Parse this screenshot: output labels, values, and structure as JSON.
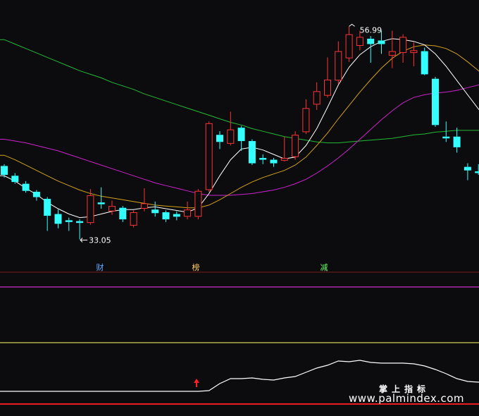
{
  "chart_data": {
    "type": "candlestick",
    "ylim": [
      30,
      59
    ],
    "price_labels": {
      "high": "56.99",
      "low": "33.05"
    },
    "event_markers": [
      "财",
      "榜",
      "减"
    ],
    "candles": [
      {
        "o": 41.3,
        "c": 40.3,
        "h": 41.5,
        "l": 40.0,
        "up": false
      },
      {
        "o": 40.2,
        "c": 39.5,
        "h": 40.5,
        "l": 39.3,
        "up": false
      },
      {
        "o": 39.3,
        "c": 38.5,
        "h": 39.6,
        "l": 38.3,
        "up": false
      },
      {
        "o": 38.4,
        "c": 37.8,
        "h": 38.6,
        "l": 37.4,
        "up": false
      },
      {
        "o": 37.6,
        "c": 35.7,
        "h": 37.8,
        "l": 34.0,
        "up": false
      },
      {
        "o": 35.9,
        "c": 34.8,
        "h": 36.4,
        "l": 34.3,
        "up": false
      },
      {
        "o": 35.2,
        "c": 35.0,
        "h": 35.5,
        "l": 34.0,
        "up": false
      },
      {
        "o": 35.1,
        "c": 34.9,
        "h": 35.3,
        "l": 33.05,
        "up": false
      },
      {
        "o": 34.9,
        "c": 38.0,
        "h": 38.7,
        "l": 34.7,
        "up": true
      },
      {
        "o": 37.2,
        "c": 37.0,
        "h": 38.9,
        "l": 36.5,
        "up": false
      },
      {
        "o": 36.8,
        "c": 36.2,
        "h": 37.4,
        "l": 35.8,
        "up": true
      },
      {
        "o": 36.6,
        "c": 35.3,
        "h": 36.8,
        "l": 35.0,
        "up": false
      },
      {
        "o": 34.6,
        "c": 36.1,
        "h": 36.3,
        "l": 34.4,
        "up": true
      },
      {
        "o": 36.5,
        "c": 37.1,
        "h": 38.8,
        "l": 36.2,
        "up": true
      },
      {
        "o": 36.4,
        "c": 36.0,
        "h": 37.3,
        "l": 35.6,
        "up": false
      },
      {
        "o": 36.1,
        "c": 35.3,
        "h": 36.3,
        "l": 35.0,
        "up": false
      },
      {
        "o": 35.9,
        "c": 35.6,
        "h": 36.2,
        "l": 35.2,
        "up": false
      },
      {
        "o": 35.6,
        "c": 36.4,
        "h": 37.3,
        "l": 35.3,
        "up": true
      },
      {
        "o": 35.6,
        "c": 38.5,
        "h": 38.7,
        "l": 35.3,
        "up": true
      },
      {
        "o": 38.6,
        "c": 46.1,
        "h": 46.3,
        "l": 38.4,
        "up": true
      },
      {
        "o": 44.8,
        "c": 44.0,
        "h": 45.2,
        "l": 43.2,
        "up": false
      },
      {
        "o": 43.8,
        "c": 45.4,
        "h": 47.4,
        "l": 43.6,
        "up": true
      },
      {
        "o": 45.6,
        "c": 44.1,
        "h": 45.8,
        "l": 43.0,
        "up": false
      },
      {
        "o": 44.1,
        "c": 41.6,
        "h": 44.3,
        "l": 41.4,
        "up": false
      },
      {
        "o": 42.2,
        "c": 42.0,
        "h": 42.6,
        "l": 41.5,
        "up": false
      },
      {
        "o": 42.0,
        "c": 41.6,
        "h": 42.2,
        "l": 41.2,
        "up": false
      },
      {
        "o": 41.9,
        "c": 42.2,
        "h": 44.6,
        "l": 41.8,
        "up": true
      },
      {
        "o": 42.3,
        "c": 44.8,
        "h": 45.2,
        "l": 42.0,
        "up": true
      },
      {
        "o": 45.1,
        "c": 47.8,
        "h": 48.8,
        "l": 44.9,
        "up": true
      },
      {
        "o": 48.2,
        "c": 49.7,
        "h": 50.7,
        "l": 47.6,
        "up": true
      },
      {
        "o": 49.2,
        "c": 51.0,
        "h": 53.5,
        "l": 49.0,
        "up": true
      },
      {
        "o": 50.9,
        "c": 54.2,
        "h": 55.3,
        "l": 50.5,
        "up": true
      },
      {
        "o": 53.4,
        "c": 56.1,
        "h": 56.99,
        "l": 53.0,
        "up": true
      },
      {
        "o": 55.8,
        "c": 54.8,
        "h": 56.5,
        "l": 54.3,
        "up": true
      },
      {
        "o": 55.6,
        "c": 55.0,
        "h": 55.9,
        "l": 52.9,
        "up": false
      },
      {
        "o": 55.0,
        "c": 55.4,
        "h": 56.5,
        "l": 53.9,
        "up": false
      },
      {
        "o": 53.7,
        "c": 54.2,
        "h": 56.5,
        "l": 52.3,
        "up": true
      },
      {
        "o": 54.0,
        "c": 55.8,
        "h": 56.1,
        "l": 52.9,
        "up": true
      },
      {
        "o": 54.0,
        "c": 54.3,
        "h": 55.2,
        "l": 52.5,
        "up": true
      },
      {
        "o": 54.2,
        "c": 51.6,
        "h": 54.6,
        "l": 51.5,
        "up": false
      },
      {
        "o": 51.1,
        "c": 45.9,
        "h": 51.3,
        "l": 45.7,
        "up": false
      },
      {
        "o": 44.6,
        "c": 44.4,
        "h": 46.3,
        "l": 44.0,
        "up": false
      },
      {
        "o": 44.6,
        "c": 43.4,
        "h": 45.6,
        "l": 42.8,
        "up": false
      },
      {
        "o": 41.2,
        "c": 40.8,
        "h": 41.6,
        "l": 39.7,
        "up": false
      },
      {
        "o": 40.7,
        "c": 40.5,
        "h": 41.5,
        "l": 40.3,
        "up": false
      },
      {
        "o": 40.4,
        "c": 42.9,
        "h": 43.4,
        "l": 40.2,
        "up": true
      },
      {
        "o": 42.6,
        "c": 42.9,
        "h": 43.8,
        "l": 40.5,
        "up": true
      },
      {
        "o": 42.3,
        "c": 42.1,
        "h": 43.5,
        "l": 41.7,
        "up": false
      }
    ],
    "ma_white": [
      40.2,
      39.6,
      38.8,
      38.1,
      37.2,
      36.5,
      35.9,
      35.5,
      35.6,
      35.9,
      36.2,
      36.4,
      36.4,
      36.6,
      36.7,
      36.5,
      36.3,
      36.1,
      36.6,
      38.2,
      40.2,
      42.0,
      43.2,
      43.4,
      43.1,
      42.6,
      42.1,
      42.3,
      43.6,
      45.5,
      47.9,
      50.4,
      52.4,
      53.8,
      54.7,
      55.3,
      55.6,
      55.5,
      55.3,
      54.9,
      53.9,
      52.5,
      50.9,
      49.3,
      47.7,
      46.3,
      45.4,
      44.9
    ],
    "ma_yellow": [
      42.5,
      42.0,
      41.4,
      40.8,
      40.2,
      39.6,
      39.1,
      38.6,
      38.2,
      37.9,
      37.7,
      37.5,
      37.3,
      37.1,
      36.9,
      36.8,
      36.7,
      36.6,
      36.6,
      36.9,
      37.5,
      38.2,
      38.9,
      39.5,
      40.0,
      40.4,
      40.8,
      41.4,
      42.3,
      43.6,
      45.0,
      46.6,
      48.1,
      49.6,
      51.0,
      52.3,
      53.4,
      54.2,
      54.7,
      54.9,
      54.8,
      54.5,
      53.9,
      53.0,
      52.0,
      51.0,
      50.0,
      49.2
    ],
    "ma_magenta": [
      44.3,
      44.1,
      43.9,
      43.6,
      43.3,
      43.0,
      42.6,
      42.2,
      41.8,
      41.4,
      41.0,
      40.6,
      40.2,
      39.8,
      39.4,
      39.1,
      38.8,
      38.5,
      38.2,
      38.0,
      38.0,
      38.0,
      38.1,
      38.2,
      38.4,
      38.6,
      38.9,
      39.3,
      39.8,
      40.5,
      41.3,
      42.2,
      43.2,
      44.3,
      45.4,
      46.5,
      47.5,
      48.4,
      49.0,
      49.3,
      49.5,
      49.6,
      49.8,
      50.1,
      50.4,
      50.7,
      51.0,
      51.3
    ],
    "ma_green": [
      55.5,
      55.0,
      54.5,
      54.0,
      53.5,
      53.0,
      52.5,
      52.0,
      51.6,
      51.2,
      50.7,
      50.3,
      49.9,
      49.4,
      49.0,
      48.6,
      48.2,
      47.8,
      47.4,
      47.0,
      46.6,
      46.2,
      45.9,
      45.5,
      45.2,
      44.9,
      44.6,
      44.4,
      44.2,
      44.0,
      43.9,
      43.9,
      44.0,
      44.1,
      44.2,
      44.3,
      44.4,
      44.6,
      44.8,
      44.9,
      45.1,
      45.2,
      45.3,
      45.3,
      45.3,
      45.3,
      45.3,
      45.3
    ],
    "indicator_line": [
      555,
      555,
      555,
      555,
      555,
      555,
      555,
      555,
      555,
      555,
      555,
      555,
      555,
      555,
      555,
      555,
      555,
      555,
      555,
      554,
      544,
      537,
      537,
      536,
      538,
      539,
      536,
      534,
      528,
      522,
      518,
      512,
      513,
      511,
      514,
      515,
      515,
      515,
      516,
      519,
      524,
      530,
      537,
      541,
      542,
      542,
      543,
      545
    ],
    "panel2_lines": [
      {
        "y": 407,
        "color": "#ff33ff"
      },
      {
        "y": 486,
        "color": "#ffff66"
      }
    ]
  }
}
